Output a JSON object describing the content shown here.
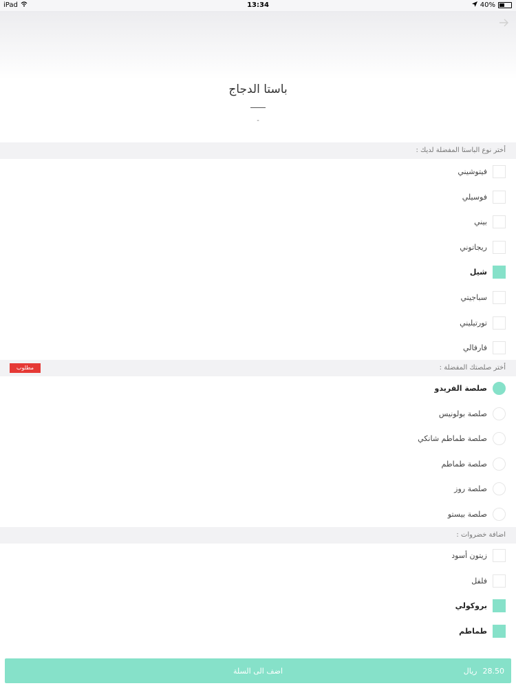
{
  "status": {
    "device": "iPad",
    "time": "13:34",
    "battery": "40%",
    "battery_level": 0.4
  },
  "header": {
    "title": "باستا الدجاج",
    "dot": "-"
  },
  "section_pasta": {
    "label": "أختر نوع الباستا المفضلة لديك :",
    "items": [
      {
        "label": "فيتوشيني",
        "checked": false
      },
      {
        "label": "فوسيلي",
        "checked": false
      },
      {
        "label": "بيني",
        "checked": false
      },
      {
        "label": "ريجاتوني",
        "checked": false
      },
      {
        "label": "شيل",
        "checked": true
      },
      {
        "label": "سباجيتي",
        "checked": false
      },
      {
        "label": "تورتيليني",
        "checked": false
      },
      {
        "label": "فارفالي",
        "checked": false
      }
    ]
  },
  "section_sauce": {
    "label": "أختر صلصتك المفضلة :",
    "badge": "مطلوب",
    "items": [
      {
        "label": "صلصة الفريدو",
        "checked": true
      },
      {
        "label": "صلصة بولونيس",
        "checked": false
      },
      {
        "label": "صلصة طماطم شانكي",
        "checked": false
      },
      {
        "label": "صلصة طماطم",
        "checked": false
      },
      {
        "label": "صلصة روز",
        "checked": false
      },
      {
        "label": "صلصة بيستو",
        "checked": false
      }
    ]
  },
  "section_veg": {
    "label": "اضافة خضروات :",
    "items": [
      {
        "label": "زيتون أسود",
        "checked": false
      },
      {
        "label": "فلفل",
        "checked": false
      },
      {
        "label": "بروكولي",
        "checked": true
      },
      {
        "label": "طماطم",
        "checked": true
      }
    ]
  },
  "footer": {
    "price_value": "28.50",
    "currency": "ريال",
    "cta": "اضف الى السلة"
  },
  "colors": {
    "accent": "#86e1c9",
    "required": "#e53935"
  },
  "icons": {
    "back": "arrow-right-icon",
    "location": "location-arrow-icon",
    "wifi": "wifi-icon"
  }
}
